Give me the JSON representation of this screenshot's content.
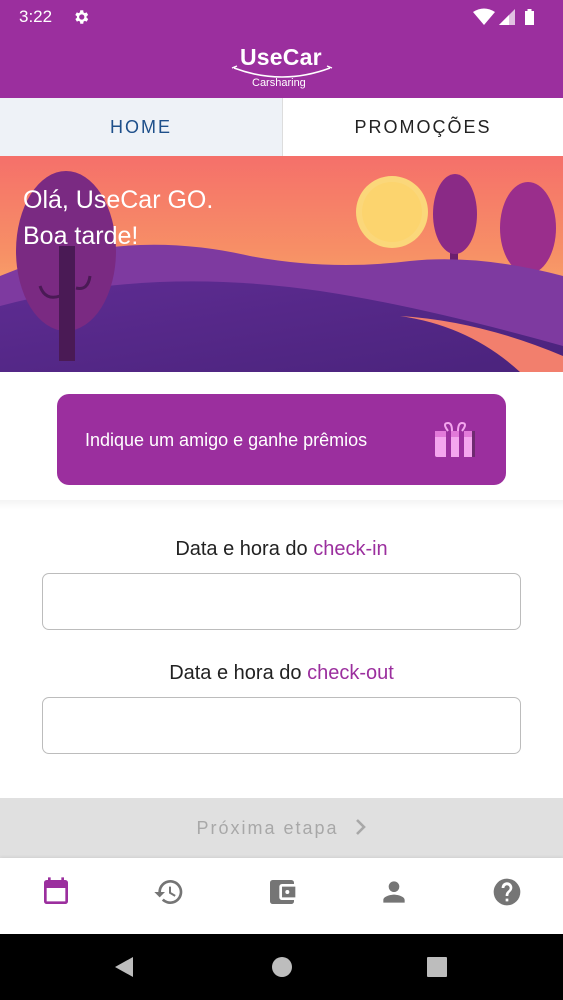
{
  "status_bar": {
    "time": "3:22",
    "icons": [
      "gear-icon",
      "wifi-icon",
      "signal-icon",
      "battery-icon"
    ]
  },
  "header": {
    "logo_text": "UseCar",
    "logo_subtitle": "Carsharing"
  },
  "tabs": [
    {
      "label": "HOME",
      "active": true
    },
    {
      "label": "PROMOÇÕES",
      "active": false
    }
  ],
  "banner": {
    "greeting_line1": "Olá, UseCar GO.",
    "greeting_line2": "Boa tarde!"
  },
  "referral": {
    "label": "Indique um amigo e ganhe prêmios",
    "icon": "gift-icon"
  },
  "checkin": {
    "label_prefix": "Data e hora do",
    "label_accent": "check-in",
    "value": ""
  },
  "checkout": {
    "label_prefix": "Data e hora do",
    "label_accent": "check-out",
    "value": ""
  },
  "next_button": {
    "label": "Próxima etapa",
    "enabled": false
  },
  "bottom_nav": [
    {
      "icon": "calendar-icon",
      "active": true
    },
    {
      "icon": "history-icon",
      "active": false
    },
    {
      "icon": "wallet-icon",
      "active": false
    },
    {
      "icon": "person-icon",
      "active": false
    },
    {
      "icon": "help-icon",
      "active": false
    }
  ],
  "colors": {
    "brand": "#9b2f9e",
    "tab_active_text": "#1d4f8a",
    "nav_active": "#9b2f9e",
    "nav_inactive": "#757575"
  }
}
